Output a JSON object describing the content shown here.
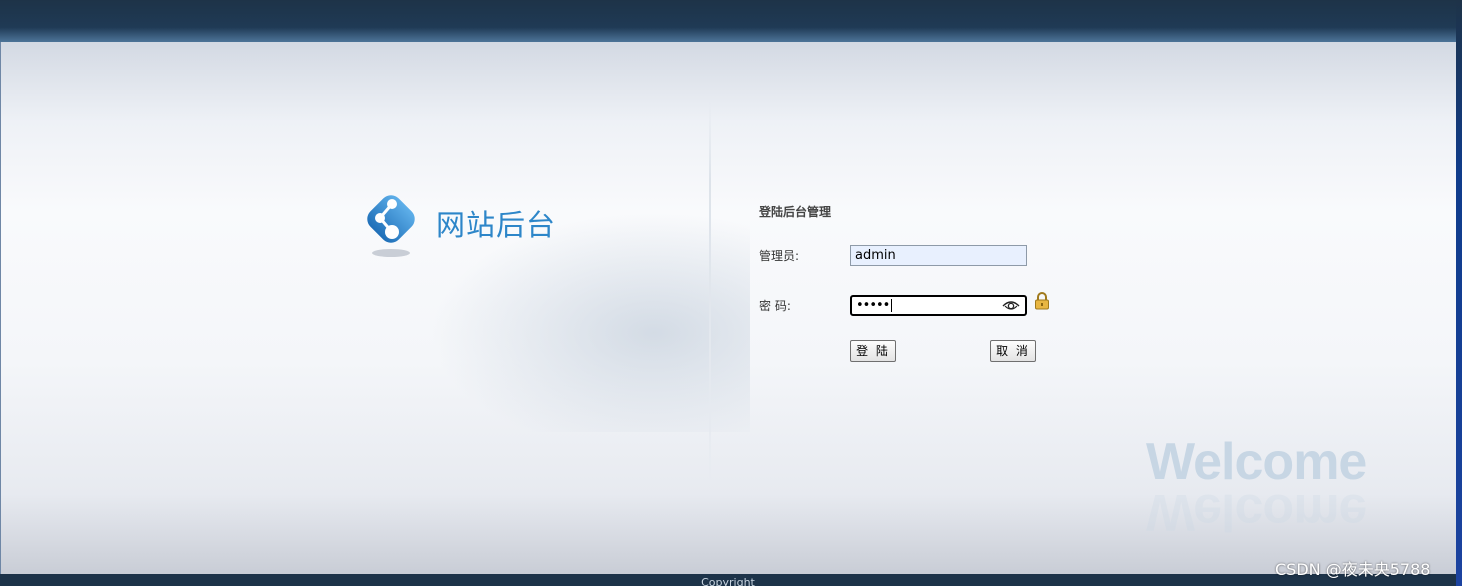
{
  "logo": {
    "text": "网站后台",
    "icon": "share-icon"
  },
  "form": {
    "title": "登陆后台管理",
    "username_label": "管理员:",
    "username_value": "admin",
    "password_label": "密 码:",
    "password_value": "•••••",
    "login_button": "登 陆",
    "cancel_button": "取 消",
    "reveal_icon": "eye-icon",
    "lock_icon": "lock-icon"
  },
  "decor": {
    "welcome": "Welcome"
  },
  "footer": {
    "copyright": "Copyright"
  },
  "watermark": "CSDN @夜未央5788",
  "colors": {
    "accent": "#2d86c9",
    "topbar": "#1e3348",
    "background": "#f4f6f9"
  }
}
